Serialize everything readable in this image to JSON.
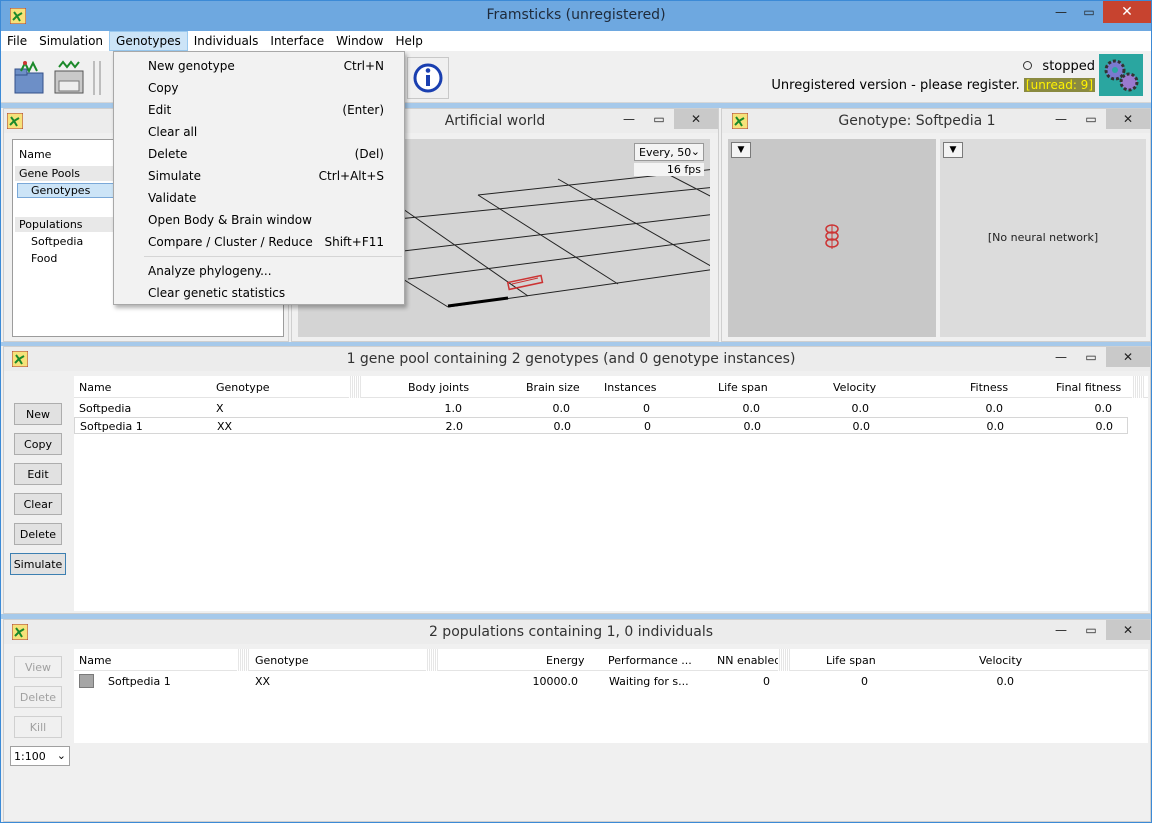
{
  "window": {
    "title": "Framsticks (unregistered)"
  },
  "menubar": [
    "File",
    "Simulation",
    "Genotypes",
    "Individuals",
    "Interface",
    "Window",
    "Help"
  ],
  "genotypes_menu": {
    "items": [
      {
        "label": "New genotype",
        "shortcut": "Ctrl+N"
      },
      {
        "label": "Copy",
        "shortcut": ""
      },
      {
        "label": "Edit",
        "shortcut": "(Enter)"
      },
      {
        "label": "Clear all",
        "shortcut": ""
      },
      {
        "label": "Delete",
        "shortcut": "(Del)"
      },
      {
        "label": "Simulate",
        "shortcut": "Ctrl+Alt+S"
      },
      {
        "label": "Validate",
        "shortcut": ""
      },
      {
        "label": "Open Body & Brain window",
        "shortcut": ""
      },
      {
        "label": "Compare / Cluster / Reduce",
        "shortcut": "Shift+F11"
      }
    ],
    "items2": [
      {
        "label": "Analyze phylogeny...",
        "shortcut": ""
      },
      {
        "label": "Clear genetic statistics",
        "shortcut": ""
      }
    ]
  },
  "toolbar": {
    "status": "stopped",
    "register_text": "Unregistered version - please register.",
    "unread": "[unread: 9]"
  },
  "tree": {
    "header": "Name",
    "gene_pools": "Gene Pools",
    "genotypes": "Genotypes",
    "populations": "Populations",
    "pop_items": [
      "Softpedia",
      "Food"
    ]
  },
  "world": {
    "title": "Artificial world",
    "every": "Every, 50",
    "fps": "16 fps"
  },
  "genotype_view": {
    "title": "Genotype: Softpedia 1",
    "no_nn": "[No neural network]"
  },
  "gene_pool": {
    "title": "1 gene pool containing 2 genotypes (and 0 genotype instances)",
    "buttons": [
      "New",
      "Copy",
      "Edit",
      "Clear",
      "Delete",
      "Simulate"
    ],
    "columns": [
      "Name",
      "Genotype",
      "Body joints",
      "Brain size",
      "Instances",
      "Life span",
      "Velocity",
      "Fitness",
      "Final fitness"
    ],
    "rows": [
      [
        "Softpedia",
        "X",
        "1.0",
        "0.0",
        "0",
        "0.0",
        "0.0",
        "0.0",
        "0.0"
      ],
      [
        "Softpedia 1",
        "XX",
        "2.0",
        "0.0",
        "0",
        "0.0",
        "0.0",
        "0.0",
        "0.0"
      ]
    ]
  },
  "populations": {
    "title": "2 populations containing 1, 0 individuals",
    "buttons": [
      "View",
      "Delete",
      "Kill"
    ],
    "zoom": "1:100",
    "columns": [
      "Name",
      "Genotype",
      "Energy",
      "Performance ...",
      "NN enabled",
      "Life span",
      "Velocity"
    ],
    "rows": [
      [
        "Softpedia 1",
        "XX",
        "10000.0",
        "Waiting for s...",
        "0",
        "0",
        "0.0"
      ]
    ]
  }
}
